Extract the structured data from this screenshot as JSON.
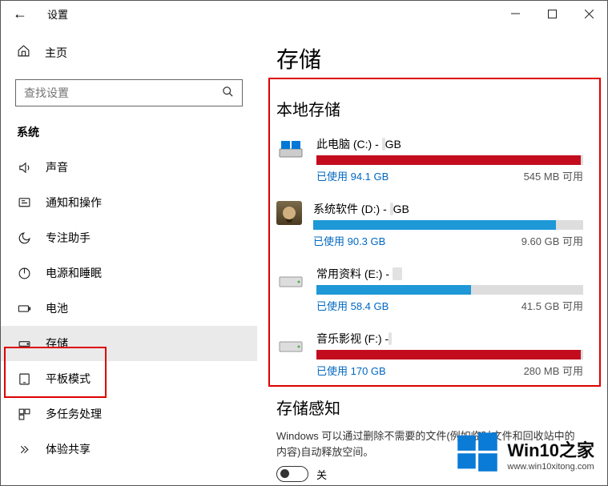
{
  "titlebar": {
    "title": "设置"
  },
  "sidebar": {
    "home": "主页",
    "search_placeholder": "查找设置",
    "category": "系统",
    "items": [
      {
        "label": "声音"
      },
      {
        "label": "通知和操作"
      },
      {
        "label": "专注助手"
      },
      {
        "label": "电源和睡眠"
      },
      {
        "label": "电池"
      },
      {
        "label": "存储"
      },
      {
        "label": "平板模式"
      },
      {
        "label": "多任务处理"
      },
      {
        "label": "体验共享"
      }
    ]
  },
  "main": {
    "title": "存储",
    "section": "本地存储",
    "used_prefix": "已使用 ",
    "free_suffix": " 可用",
    "drives": [
      {
        "name": "此电脑 (C:) - ",
        "size_hidden": "   ",
        "size_suffix": " GB",
        "used": "94.1 GB",
        "free": "545 MB",
        "percent": 99,
        "color": "red",
        "icon": "c"
      },
      {
        "name": "系统软件 (D:) - ",
        "size_hidden": "  ",
        "size_suffix": " GB",
        "used": "90.3 GB",
        "free": "9.60 GB",
        "percent": 90,
        "color": "blue",
        "icon": "avatar"
      },
      {
        "name": "常用资料 (E:) - ",
        "size_hidden": "1   ",
        "size_suffix": "",
        "used": "58.4 GB",
        "free": "41.5 GB",
        "percent": 58,
        "color": "blue",
        "icon": "hdd"
      },
      {
        "name": "音乐影视 (F:) - ",
        "size_hidden": "   ",
        "size_suffix": "",
        "used": "170 GB",
        "free": "280 MB",
        "percent": 99,
        "color": "red",
        "icon": "hdd"
      }
    ],
    "sense_head": "存储感知",
    "sense_desc": "Windows 可以通过删除不需要的文件(例如临时文件和回收站中的内容)自动释放空间。",
    "toggle_label": "关"
  },
  "watermark": {
    "big": "Win10之家",
    "small": "www.win10xitong.com"
  }
}
